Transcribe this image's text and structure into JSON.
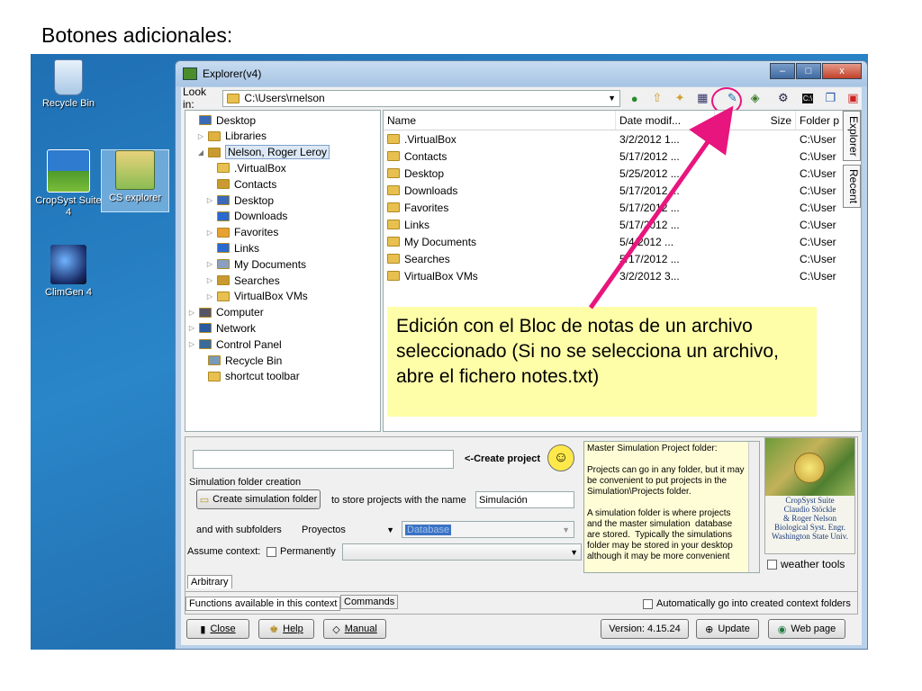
{
  "slide": {
    "title": "Botones adicionales:"
  },
  "desktop_icons": [
    {
      "label": "Recycle Bin",
      "icon": "recycle-bin-icon"
    },
    {
      "label": "CropSyst Suite 4",
      "icon": "cropsyst-icon"
    },
    {
      "label": "CS explorer",
      "icon": "cs-explorer-icon"
    },
    {
      "label": "ClimGen 4",
      "icon": "climgen-icon"
    }
  ],
  "window": {
    "title": "Explorer(v4)",
    "buttons": {
      "minimize": "–",
      "maximize": "□",
      "close": "x"
    }
  },
  "lookin": {
    "label": "Look in:",
    "path": "C:\\Users\\rnelson"
  },
  "tree": [
    {
      "label": "Desktop",
      "indent": 0,
      "expander": ""
    },
    {
      "label": "Libraries",
      "indent": 1,
      "expander": "▷"
    },
    {
      "label": "Nelson, Roger Leroy",
      "indent": 1,
      "expander": "◢",
      "selected": true
    },
    {
      "label": ".VirtualBox",
      "indent": 2,
      "expander": ""
    },
    {
      "label": "Contacts",
      "indent": 2,
      "expander": ""
    },
    {
      "label": "Desktop",
      "indent": 2,
      "expander": "▷"
    },
    {
      "label": "Downloads",
      "indent": 2,
      "expander": ""
    },
    {
      "label": "Favorites",
      "indent": 2,
      "expander": "▷"
    },
    {
      "label": "Links",
      "indent": 2,
      "expander": ""
    },
    {
      "label": "My Documents",
      "indent": 2,
      "expander": "▷"
    },
    {
      "label": "Searches",
      "indent": 2,
      "expander": "▷"
    },
    {
      "label": "VirtualBox VMs",
      "indent": 2,
      "expander": "▷"
    },
    {
      "label": "Computer",
      "indent": 0,
      "expander": "▷"
    },
    {
      "label": "Network",
      "indent": 0,
      "expander": "▷"
    },
    {
      "label": "Control Panel",
      "indent": 0,
      "expander": "▷"
    },
    {
      "label": "Recycle Bin",
      "indent": 1,
      "expander": ""
    },
    {
      "label": "shortcut toolbar",
      "indent": 1,
      "expander": ""
    }
  ],
  "list": {
    "columns": [
      "Name",
      "Date modif...",
      "Size",
      "Folder p"
    ],
    "rows": [
      {
        "name": ".VirtualBox",
        "date": "3/2/2012 1...",
        "folder": "C:\\User"
      },
      {
        "name": "Contacts",
        "date": "5/17/2012 ...",
        "folder": "C:\\User"
      },
      {
        "name": "Desktop",
        "date": "5/25/2012 ...",
        "folder": "C:\\User"
      },
      {
        "name": "Downloads",
        "date": "5/17/2012 ...",
        "folder": "C:\\User"
      },
      {
        "name": "Favorites",
        "date": "5/17/2012 ...",
        "folder": "C:\\User"
      },
      {
        "name": "Links",
        "date": "5/17/2012 ...",
        "folder": "C:\\User"
      },
      {
        "name": "My Documents",
        "date": "5/4/2012 ...",
        "folder": "C:\\User"
      },
      {
        "name": "Searches",
        "date": "5/17/2012 ...",
        "folder": "C:\\User"
      },
      {
        "name": "VirtualBox VMs",
        "date": "3/2/2012 3...",
        "folder": "C:\\User"
      }
    ],
    "side_tabs": [
      "Explorer",
      "Recent"
    ]
  },
  "callout": {
    "text": "Edición con el Bloc de notas de un archivo seleccionado (Si no se selecciona un archivo, abre el fichero notes.txt)"
  },
  "lower": {
    "create_project_label": "<-Create project",
    "create_project_value": "",
    "sim_folder_caption": "Simulation folder creation",
    "create_sim_button": "Create simulation folder",
    "store_text": "to store projects with the name",
    "sim_name_value": "Simulación",
    "subfolders_label": "and  with subfolders",
    "subfolders_value": "Proyectos",
    "database_value": "Database",
    "assume_context_label": "Assume context:",
    "permanently_label": "Permanently",
    "info_text": "Master Simulation Project folder:\n\nProjects can go in any folder, but it may be convenient to put projects in the Simulation\\Projects folder.\n\nA simulation folder is where projects and the master simulation  database are stored.  Typically the simulations folder may be stored in your desktop although it may be more convenient",
    "logo_lines": [
      "CropSyst Suite",
      "Claudio Stöckle",
      "& Roger Nelson",
      "Biological Syst. Engr.",
      "Washington State Univ."
    ],
    "weather_tools_label": "weather tools",
    "arbitrary_tab": "Arbitrary",
    "tab_functions": "Functions available in this context",
    "tab_commands": "Commands",
    "auto_context_label": "Automatically go into created context folders"
  },
  "bottom": {
    "close": "Close",
    "help": "Help",
    "manual": "Manual",
    "version": "Version: 4.15.24",
    "update": "Update",
    "webpage": "Web page"
  },
  "colors": {
    "accent_pink": "#e8157e",
    "callout_bg": "#fefea8",
    "desktop_blue": "#2a86c9"
  }
}
